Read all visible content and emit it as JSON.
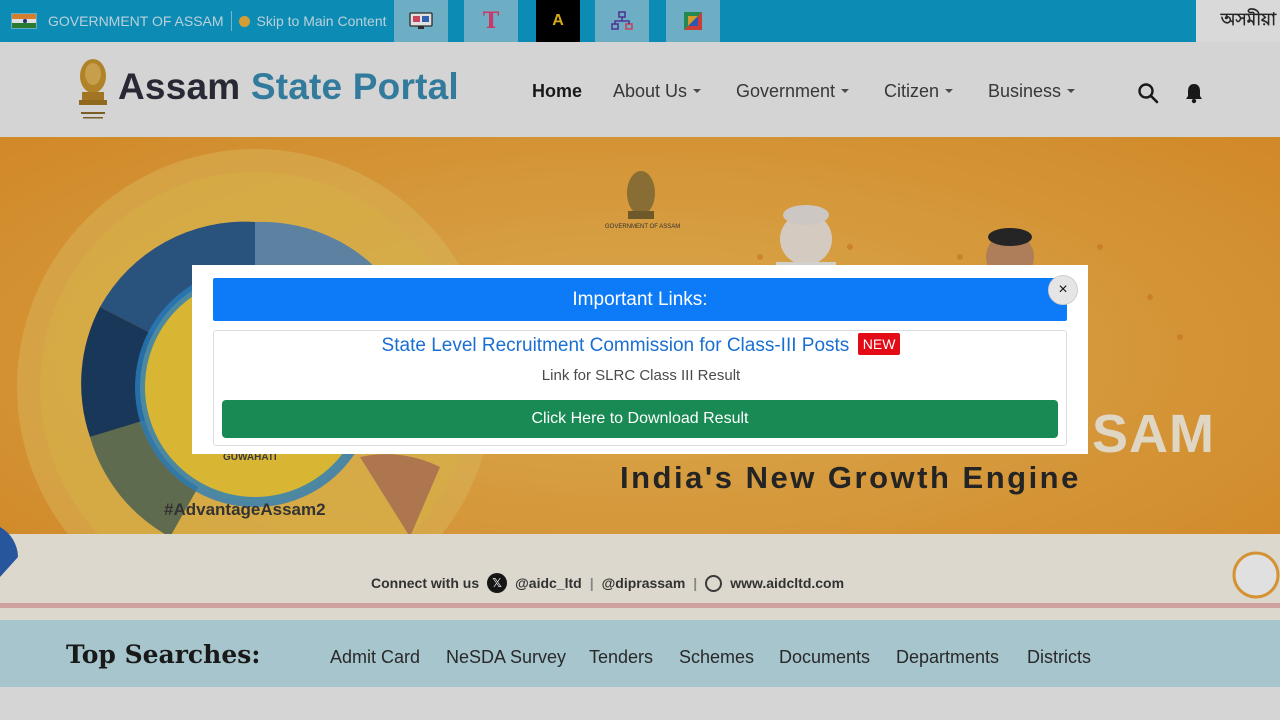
{
  "topbar": {
    "government_label": "GOVERNMENT OF ASSAM",
    "skip_label": "Skip to Main Content",
    "contrast_glyph": "A",
    "text_tool_glyph": "T",
    "language_label": "অসমীয়া",
    "tools": [
      "screen-reader-icon",
      "text-size-icon",
      "contrast-icon",
      "sitemap-icon",
      "theme-color-icon"
    ]
  },
  "header": {
    "brand_part1": "Assam",
    "brand_part2": "State Portal",
    "nav": [
      {
        "label": "Home"
      },
      {
        "label": "About Us"
      },
      {
        "label": "Government"
      },
      {
        "label": "Citizen"
      },
      {
        "label": "Business"
      }
    ],
    "icons": [
      "search-icon",
      "bell-icon"
    ]
  },
  "banner": {
    "tagline": "India's New Growth Engine",
    "big_word": "SAM",
    "hashtag": "#AdvantageAssam2",
    "city": "GUWAHATI",
    "gov_caption": "GOVERNMENT OF ASSAM",
    "connect_label": "Connect with us",
    "handle_x": "@aidc_ltd",
    "handle_fb": "@diprassam",
    "website": "www.aidcltd.com",
    "sep": "|"
  },
  "top_searches": {
    "title": "Top Searches:",
    "links": [
      "Admit Card",
      "NeSDA Survey",
      "Tenders",
      "Schemes",
      "Documents",
      "Departments",
      "Districts"
    ]
  },
  "modal": {
    "title": "Important Links:",
    "close_glyph": "×",
    "recruitment_link": "State Level Recruitment Commission for Class-III Posts",
    "new_badge": "NEW",
    "subtitle": "Link for SLRC Class III Result",
    "download_button": "Click Here to Download Result"
  },
  "colors": {
    "topbar": "#0e9fcf",
    "brand_accent": "#3b8db3",
    "modal_header": "#0d7bf7",
    "download_button": "#198a54",
    "new_badge": "#e30b16"
  }
}
